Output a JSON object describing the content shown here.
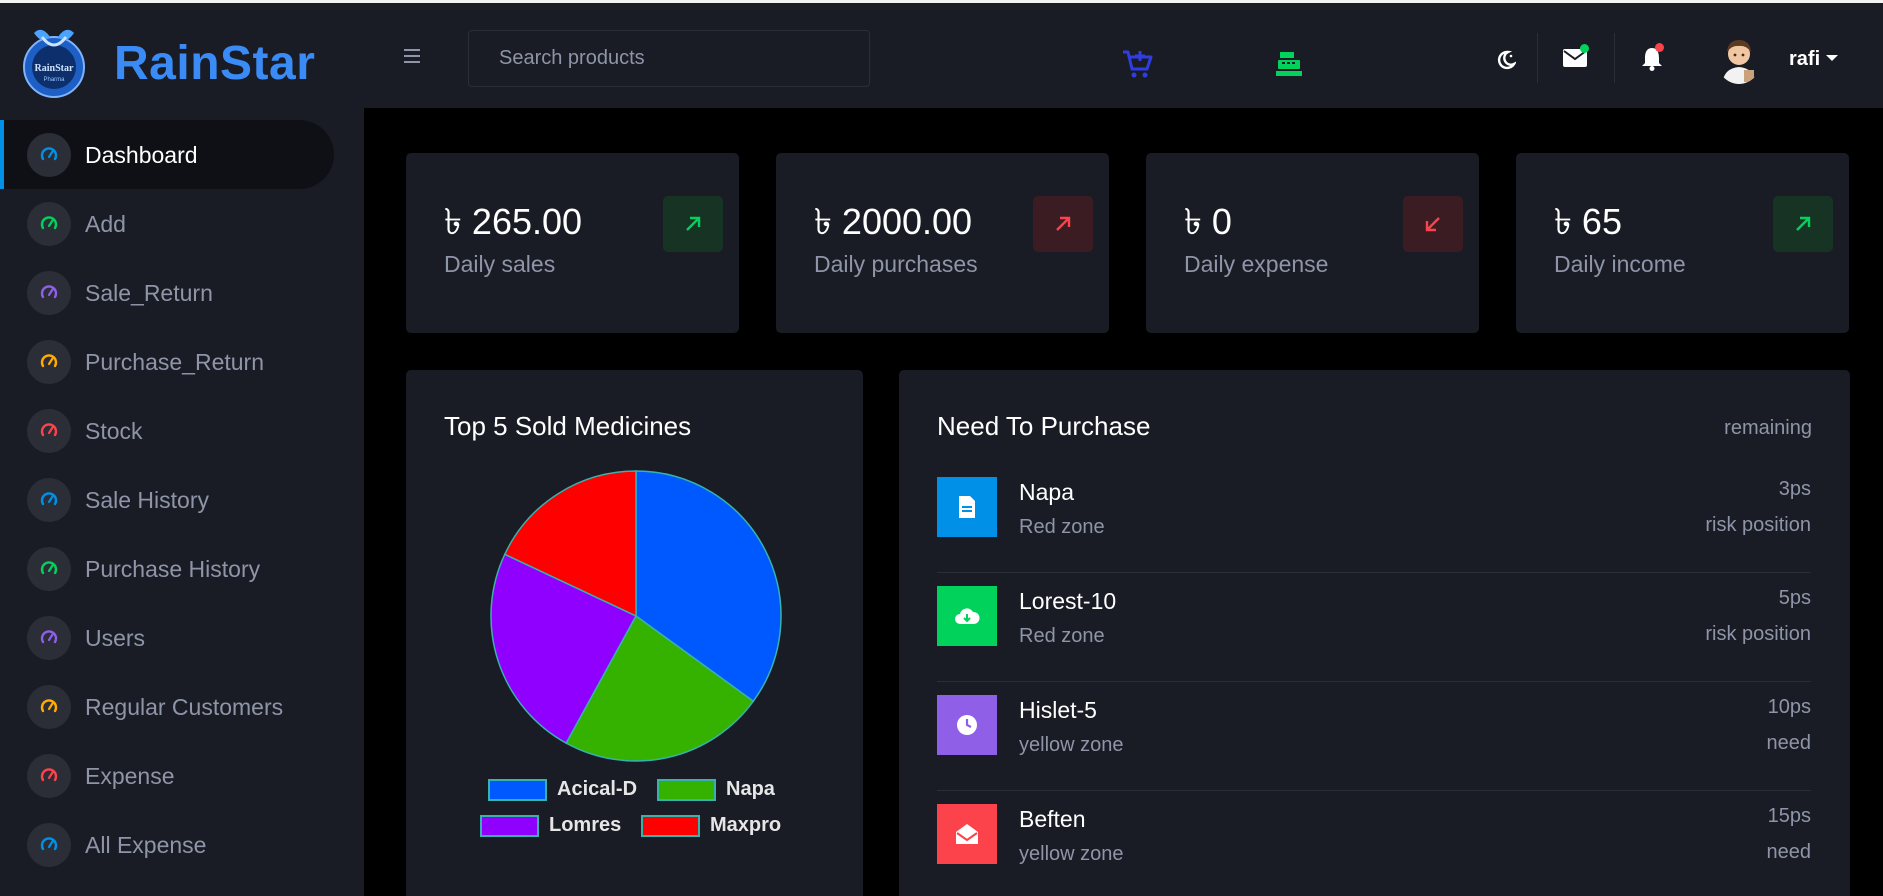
{
  "brand": {
    "name": "RainStar",
    "logo_text": "RainStar",
    "logo_subtext": "Pharma"
  },
  "header": {
    "search_placeholder": "Search products",
    "icons": [
      "menu-icon",
      "cart-plus-icon",
      "cash-register-icon",
      "theme-toggle-icon",
      "mail-icon",
      "bell-icon"
    ],
    "user": {
      "name": "rafi"
    },
    "colors": {
      "cart": "#2f3ee3",
      "register": "#00d25b",
      "mail_dot": "#00d25b",
      "bell_dot": "#fc424a"
    }
  },
  "sidebar": {
    "items": [
      {
        "label": "Dashboard",
        "icon": "speedometer-icon",
        "color": "#0090e7",
        "active": true
      },
      {
        "label": "Add",
        "icon": "speedometer-icon",
        "color": "#00d25b"
      },
      {
        "label": "Sale_Return",
        "icon": "speedometer-icon",
        "color": "#8f5fe8"
      },
      {
        "label": "Purchase_Return",
        "icon": "speedometer-icon",
        "color": "#ffab00"
      },
      {
        "label": "Stock",
        "icon": "speedometer-icon",
        "color": "#fc424a"
      },
      {
        "label": "Sale History",
        "icon": "speedometer-icon",
        "color": "#0090e7"
      },
      {
        "label": "Purchase History",
        "icon": "speedometer-icon",
        "color": "#00d25b"
      },
      {
        "label": "Users",
        "icon": "speedometer-icon",
        "color": "#8f5fe8"
      },
      {
        "label": "Regular Customers",
        "icon": "speedometer-icon",
        "color": "#ffab00"
      },
      {
        "label": "Expense",
        "icon": "speedometer-icon",
        "color": "#fc424a"
      },
      {
        "label": "All Expense",
        "icon": "speedometer-icon",
        "color": "#0090e7"
      }
    ]
  },
  "stats": [
    {
      "value": "৳ 265.00",
      "label": "Daily sales",
      "trend": "up",
      "color": "#00d25b",
      "bg": "#163324"
    },
    {
      "value": "৳ 2000.00",
      "label": "Daily purchases",
      "trend": "up",
      "color": "#fc424a",
      "bg": "#3a1c22"
    },
    {
      "value": "৳ 0",
      "label": "Daily expense",
      "trend": "down",
      "color": "#fc424a",
      "bg": "#3a1c22"
    },
    {
      "value": "৳ 65",
      "label": "Daily income",
      "trend": "up",
      "color": "#00d25b",
      "bg": "#163324"
    }
  ],
  "top_sold": {
    "title": "Top 5 Sold Medicines"
  },
  "chart_data": {
    "type": "pie",
    "categories": [
      "Acical-D",
      "Napa",
      "Lomres",
      "Maxpro"
    ],
    "values": [
      35,
      23,
      24,
      18
    ],
    "colors": [
      "#0059ff",
      "#35b200",
      "#8f00ff",
      "#ff0000"
    ],
    "legend": "bottom"
  },
  "need_purchase": {
    "title": "Need To Purchase",
    "column_label": "remaining",
    "items": [
      {
        "name": "Napa",
        "zone": "Red zone",
        "qty": "3ps",
        "status": "risk position",
        "icon": "document-icon",
        "color": "#0090e7"
      },
      {
        "name": "Lorest-10",
        "zone": "Red zone",
        "qty": "5ps",
        "status": "risk position",
        "icon": "cloud-download-icon",
        "color": "#00d25b"
      },
      {
        "name": "Hislet-5",
        "zone": "yellow zone",
        "qty": "10ps",
        "status": "need",
        "icon": "clock-icon",
        "color": "#8f5fe8"
      },
      {
        "name": "Beften",
        "zone": "yellow zone",
        "qty": "15ps",
        "status": "need",
        "icon": "mail-open-icon",
        "color": "#fc424a"
      }
    ]
  }
}
